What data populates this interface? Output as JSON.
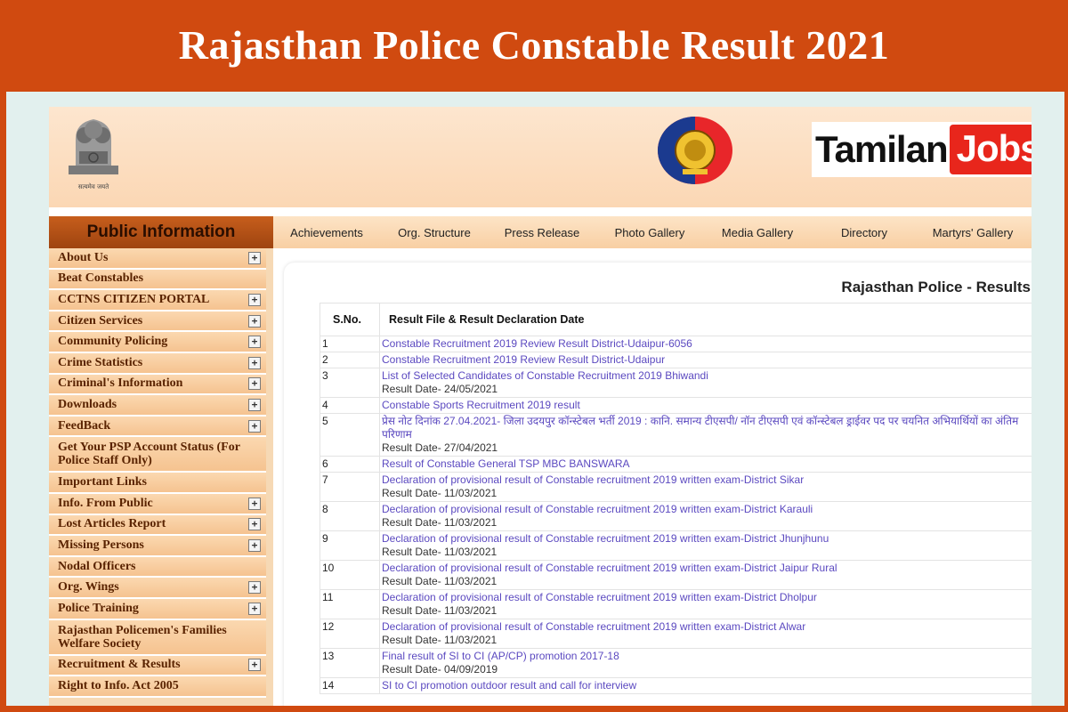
{
  "banner": {
    "title": "Rajasthan Police Constable Result 2021"
  },
  "header": {
    "emblem_caption": "सत्यमेव जयते",
    "brand_part1": "Tamilan",
    "brand_part2": "Jobs"
  },
  "sidebar": {
    "title": "Public Information",
    "items": [
      {
        "label": "About Us",
        "expandable": true
      },
      {
        "label": "Beat Constables",
        "expandable": false
      },
      {
        "label": "CCTNS CITIZEN PORTAL",
        "expandable": true
      },
      {
        "label": "Citizen Services",
        "expandable": true
      },
      {
        "label": "Community Policing",
        "expandable": true
      },
      {
        "label": "Crime Statistics",
        "expandable": true
      },
      {
        "label": "Criminal's Information",
        "expandable": true
      },
      {
        "label": "Downloads",
        "expandable": true
      },
      {
        "label": "FeedBack",
        "expandable": true
      },
      {
        "label": "Get Your PSP Account Status (For Police Staff Only)",
        "expandable": false,
        "tall": true
      },
      {
        "label": "Important Links",
        "expandable": false
      },
      {
        "label": "Info. From Public",
        "expandable": true
      },
      {
        "label": "Lost Articles Report",
        "expandable": true
      },
      {
        "label": "Missing Persons",
        "expandable": true
      },
      {
        "label": "Nodal Officers",
        "expandable": false
      },
      {
        "label": "Org. Wings",
        "expandable": true
      },
      {
        "label": "Police Training",
        "expandable": true
      },
      {
        "label": "Rajasthan Policemen's Families Welfare Society",
        "expandable": false,
        "tall": true
      },
      {
        "label": "Recruitment & Results",
        "expandable": true
      },
      {
        "label": "Right to Info. Act 2005",
        "expandable": false
      }
    ]
  },
  "nav": {
    "items": [
      "Achievements",
      "Org. Structure",
      "Press Release",
      "Photo Gallery",
      "Media Gallery",
      "Directory",
      "Martyrs' Gallery"
    ]
  },
  "main": {
    "title": "Rajasthan Police - Results",
    "columns": [
      "S.No.",
      "Result File & Result Declaration Date"
    ],
    "rows": [
      {
        "sn": "1",
        "title": "Constable Recruitment 2019 Review Result District-Udaipur-6056",
        "date": ""
      },
      {
        "sn": "2",
        "title": "Constable Recruitment 2019 Review Result District-Udaipur",
        "date": ""
      },
      {
        "sn": "3",
        "title": "List of Selected Candidates of Constable Recruitment 2019 Bhiwandi",
        "date": "Result Date- 24/05/2021"
      },
      {
        "sn": "4",
        "title": "Constable Sports Recruitment 2019 result",
        "date": ""
      },
      {
        "sn": "5",
        "title": "प्रेस नोट दिनांक 27.04.2021- जिला उदयपुर कॉन्स्टेबल भर्ती 2019 : कानि. समान्य टीएसपी/ नॉन टीएसपी एवं कॉन्स्टेबल ड्राईवर पद पर चयनित अभियार्थियों का अंतिम परिणाम",
        "date": "Result Date- 27/04/2021"
      },
      {
        "sn": "6",
        "title": "Result of Constable General TSP MBC BANSWARA",
        "date": ""
      },
      {
        "sn": "7",
        "title": "Declaration of provisional result of Constable recruitment 2019 written exam-District Sikar",
        "date": "Result Date- 11/03/2021"
      },
      {
        "sn": "8",
        "title": "Declaration of provisional result of Constable recruitment 2019 written exam-District Karauli",
        "date": "Result Date- 11/03/2021"
      },
      {
        "sn": "9",
        "title": "Declaration of provisional result of Constable recruitment 2019 written exam-District Jhunjhunu",
        "date": "Result Date- 11/03/2021"
      },
      {
        "sn": "10",
        "title": "Declaration of provisional result of Constable recruitment 2019 written exam-District Jaipur Rural",
        "date": "Result Date- 11/03/2021"
      },
      {
        "sn": "11",
        "title": "Declaration of provisional result of Constable recruitment 2019 written exam-District Dholpur",
        "date": "Result Date- 11/03/2021"
      },
      {
        "sn": "12",
        "title": "Declaration of provisional result of Constable recruitment 2019 written exam-District Alwar",
        "date": "Result Date- 11/03/2021"
      },
      {
        "sn": "13",
        "title": "Final result of SI to CI (AP/CP) promotion 2017-18",
        "date": "Result Date- 04/09/2019"
      },
      {
        "sn": "14",
        "title": "SI to CI promotion outdoor result and call for interview",
        "date": ""
      }
    ]
  },
  "colors": {
    "banner": "#d04a10",
    "link": "#5b49c0",
    "sidebar": "#f6d9b5"
  }
}
